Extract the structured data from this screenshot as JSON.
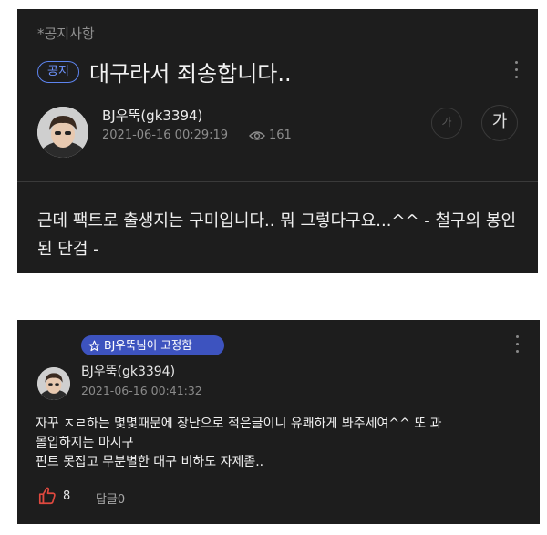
{
  "post": {
    "category": "*공지사항",
    "notice_badge": "공지",
    "title": "대구라서 죄송합니다..",
    "author": "BJ우뚝(gk3394)",
    "date": "2021-06-16 00:29:19",
    "views": "161",
    "font_small_label": "가",
    "font_large_label": "가",
    "body": "근데 팩트로 출생지는 구미입니다.. 뭐 그렇다구요...^^  - 철구의 봉인된 단검 -"
  },
  "comment": {
    "pinned_badge": "BJ우뚝님이 고정함",
    "author": "BJ우뚝(gk3394)",
    "date": "2021-06-16 00:41:32",
    "lines": [
      "자꾸 ㅈㄹ하는 몇몇때문에 장난으로 적은글이니 유쾌하게 봐주세여^^ 또 과",
      "몰입하지는 마시구",
      "핀트 못잡고 무분별한 대구 비하도 자제좀.."
    ],
    "likes": "8",
    "reply_label": "답글0"
  },
  "colors": {
    "panel_bg": "#1d1d1d",
    "notice_accent": "#5d84ef",
    "pinned_bg": "#3d53bf",
    "like_red": "#e0493f"
  },
  "icons": [
    "more-vertical-icon",
    "eye-icon",
    "star-icon",
    "thumbs-up-icon"
  ]
}
